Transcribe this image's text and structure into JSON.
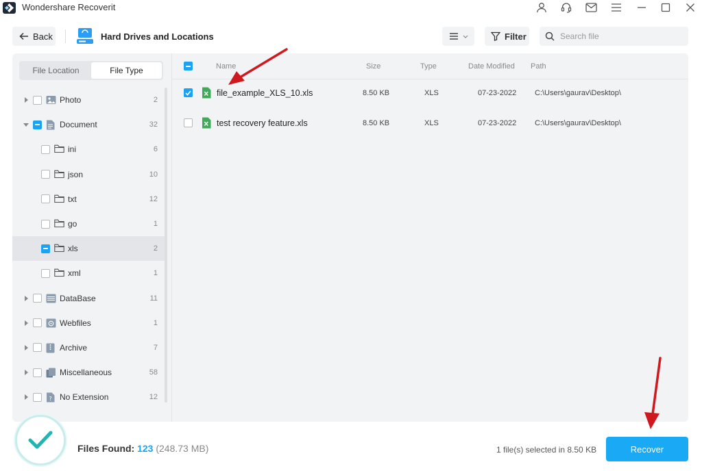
{
  "window": {
    "title": "Wondershare Recoverit",
    "logo_icon": "recoverit-logo-icon",
    "controls": [
      "account-icon",
      "support-icon",
      "mail-icon",
      "menu-icon",
      "minimize-icon",
      "maximize-icon",
      "close-icon"
    ]
  },
  "toolbar": {
    "back_label": "Back",
    "location_title": "Hard Drives and Locations",
    "filter_label": "Filter",
    "search_placeholder": "Search file"
  },
  "sidebar": {
    "tabs": [
      {
        "label": "File Location",
        "active": false
      },
      {
        "label": "File Type",
        "active": true
      }
    ],
    "tree": [
      {
        "label": "Photo",
        "count": "2",
        "level": 0,
        "expanded": false,
        "check": "none",
        "icon": "photo-icon"
      },
      {
        "label": "Document",
        "count": "32",
        "level": 0,
        "expanded": true,
        "check": "partial",
        "icon": "document-icon"
      },
      {
        "label": "ini",
        "count": "6",
        "level": 1,
        "check": "none",
        "icon": "folder-icon"
      },
      {
        "label": "json",
        "count": "10",
        "level": 1,
        "check": "none",
        "icon": "folder-icon"
      },
      {
        "label": "txt",
        "count": "12",
        "level": 1,
        "check": "none",
        "icon": "folder-icon"
      },
      {
        "label": "go",
        "count": "1",
        "level": 1,
        "check": "none",
        "icon": "folder-icon"
      },
      {
        "label": "xls",
        "count": "2",
        "level": 1,
        "check": "partial",
        "icon": "folder-icon",
        "selected": true
      },
      {
        "label": "xml",
        "count": "1",
        "level": 1,
        "check": "none",
        "icon": "folder-icon"
      },
      {
        "label": "DataBase",
        "count": "11",
        "level": 0,
        "expanded": false,
        "check": "none",
        "icon": "database-icon"
      },
      {
        "label": "Webfiles",
        "count": "1",
        "level": 0,
        "expanded": false,
        "check": "none",
        "icon": "webfiles-icon"
      },
      {
        "label": "Archive",
        "count": "7",
        "level": 0,
        "expanded": false,
        "check": "none",
        "icon": "archive-icon"
      },
      {
        "label": "Miscellaneous",
        "count": "58",
        "level": 0,
        "expanded": false,
        "check": "none",
        "icon": "miscellaneous-icon"
      },
      {
        "label": "No Extension",
        "count": "12",
        "level": 0,
        "expanded": false,
        "check": "none",
        "icon": "no-extension-icon"
      }
    ]
  },
  "file_list": {
    "columns": {
      "name": "Name",
      "size": "Size",
      "type": "Type",
      "date": "Date Modified",
      "path": "Path"
    },
    "rows": [
      {
        "name": "file_example_XLS_10.xls",
        "size": "8.50 KB",
        "type": "XLS",
        "date": "07-23-2022",
        "path": "C:\\Users\\gaurav\\Desktop\\",
        "checked": true
      },
      {
        "name": "test recovery feature.xls",
        "size": "8.50 KB",
        "type": "XLS",
        "date": "07-23-2022",
        "path": "C:\\Users\\gaurav\\Desktop\\",
        "checked": false
      }
    ]
  },
  "footer": {
    "files_found_label": "Files Found:",
    "files_found_count": "123",
    "files_found_size": "(248.73 MB)",
    "selection_info": "1 file(s) selected in 8.50 KB",
    "recover_label": "Recover"
  },
  "colors": {
    "accent": "#1aa9f5",
    "annotation_arrow": "#d0191f",
    "xls_green": "#3faa58"
  }
}
